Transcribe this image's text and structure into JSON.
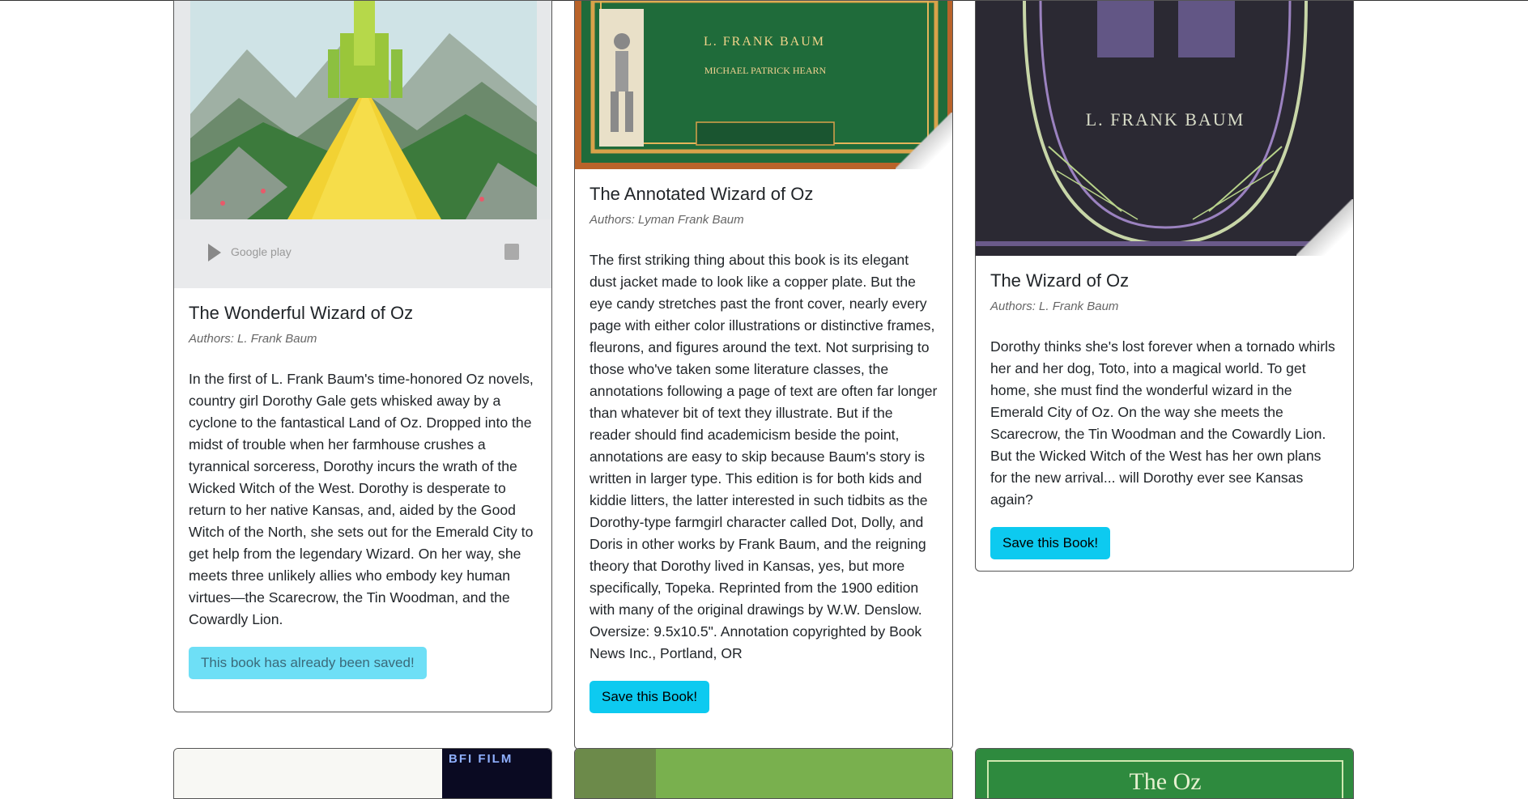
{
  "books": [
    {
      "title": "The Wonderful Wizard of Oz",
      "authors": "Authors: L. Frank Baum",
      "description": "In the first of L. Frank Baum's time-honored Oz novels, country girl Dorothy Gale gets whisked away by a cyclone to the fantastical Land of Oz. Dropped into the midst of trouble when her farmhouse crushes a tyrannical sorceress, Dorothy incurs the wrath of the Wicked Witch of the West. Dorothy is desperate to return to her native Kansas, and, aided by the Good Witch of the North, she sets out for the Emerald City to get help from the legendary Wizard. On her way, she meets three unlikely allies who embody key human virtues—the Scarecrow, the Tin Woodman, and the Cowardly Lion.",
      "button_label": "This book has already been saved!",
      "cover_badge": "Google play"
    },
    {
      "title": "The Annotated Wizard of Oz",
      "authors": "Authors: Lyman Frank Baum",
      "description": "The first striking thing about this book is its elegant dust jacket made to look like a copper plate. But the eye candy stretches past the front cover, nearly every page with either color illustrations or distinctive frames, fleurons, and figures around the text. Not surprising to those who've taken some literature classes, the annotations following a page of text are often far longer than whatever bit of text they illustrate. But if the reader should find academicism beside the point, annotations are easy to skip because Baum's story is written in larger type. This edition is for both kids and kiddie litters, the latter interested in such tidbits as the Dorothy-type farmgirl character called Dot, Dolly, and Doris in other works by Frank Baum, and the reigning theory that Dorothy lived in Kansas, yes, but more specifically, Topeka. Reprinted from the 1900 edition with many of the original drawings by W.W. Denslow. Oversize: 9.5x10.5\". Annotation copyrighted by Book News Inc., Portland, OR",
      "button_label": "Save this Book!",
      "cover_text": "L. FRANK BAUM"
    },
    {
      "title": "The Wizard of Oz",
      "authors": "Authors: L. Frank Baum",
      "description": "Dorothy thinks she's lost forever when a tornado whirls her and her dog, Toto, into a magical world. To get home, she must find the wonderful wizard in the Emerald City of Oz. On the way she meets the Scarecrow, the Tin Woodman and the Cowardly Lion. But the Wicked Witch of the West has her own plans for the new arrival... will Dorothy ever see Kansas again?",
      "button_label": "Save this Book!",
      "cover_text": "L. FRANK BAUM"
    }
  ],
  "next_row": {
    "cover1_text": "BFI FILM",
    "cover3_text": "The Oz"
  },
  "colors": {
    "button": "#0dcaf0",
    "button_saved": "#6edff6"
  }
}
